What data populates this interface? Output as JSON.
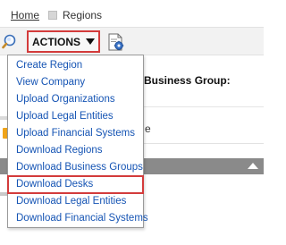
{
  "breadcrumb": {
    "home": "Home",
    "current": "Regions"
  },
  "toolbar": {
    "actions_label": "ACTIONS"
  },
  "background": {
    "field_label": "Business Group:",
    "fragment_text": "e"
  },
  "menu": {
    "items": [
      {
        "label": "Create Region"
      },
      {
        "label": "View Company"
      },
      {
        "label": "Upload Organizations"
      },
      {
        "label": "Upload Legal Entities"
      },
      {
        "label": "Upload Financial Systems"
      },
      {
        "label": "Download Regions"
      },
      {
        "label": "Download Business Groups"
      },
      {
        "label": "Download Desks",
        "highlighted": true
      },
      {
        "label": "Download Legal Entities"
      },
      {
        "label": "Download Financial Systems"
      }
    ]
  },
  "colors": {
    "link": "#1554b4",
    "highlight_border": "#d33b3b",
    "header_bar": "#8a8a8a"
  },
  "icons": [
    "search-icon",
    "report-settings-icon",
    "caret-down-icon",
    "collapse-up-icon",
    "breadcrumb-separator-icon"
  ]
}
